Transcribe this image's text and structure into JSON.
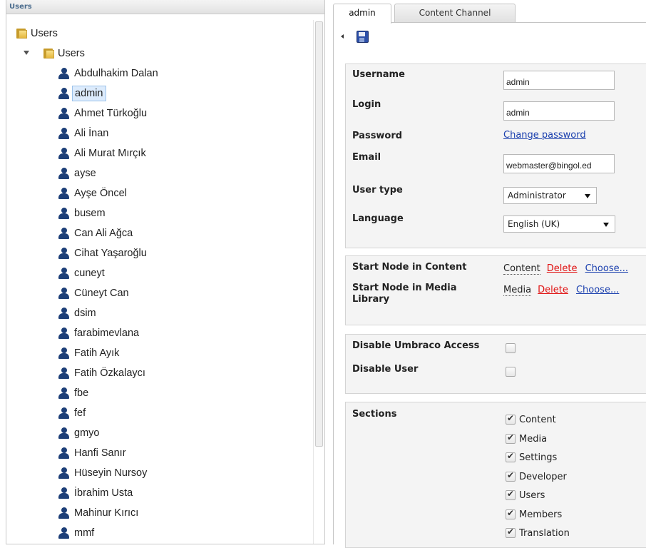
{
  "left": {
    "title": "Users",
    "root_label": "Users",
    "group_label": "Users",
    "users": [
      "Abdulhakim Dalan",
      "admin",
      "Ahmet Türkoğlu",
      "Ali İnan",
      "Ali Murat Mırçık",
      "ayse",
      "Ayşe Öncel",
      "busem",
      "Can Ali Ağca",
      "Cihat Yaşaroğlu",
      "cuneyt",
      "Cüneyt Can",
      "dsim",
      "farabimevlana",
      "Fatih Ayık",
      "Fatih Özkalaycı",
      "fbe",
      "fef",
      "gmyo",
      "Hanfi Sanır",
      "Hüseyin Nursoy",
      "İbrahim Usta",
      "Mahinur Kırıcı",
      "mmf"
    ],
    "selected_user": "admin"
  },
  "tabs": [
    "admin",
    "Content Channel"
  ],
  "form": {
    "username_label": "Username",
    "username_value": "admin",
    "login_label": "Login",
    "login_value": "admin",
    "password_label": "Password",
    "change_password": "Change password",
    "email_label": "Email",
    "email_value": "webmaster@bingol.ed",
    "usertype_label": "User type",
    "usertype_value": "Administrator",
    "language_label": "Language",
    "language_value": "English (UK)"
  },
  "start_nodes": {
    "content_label": "Start Node in Content",
    "content_node": "Content",
    "media_label": "Start Node in Media Library",
    "media_node": "Media",
    "delete_label": "Delete",
    "choose_label": "Choose..."
  },
  "access": {
    "disable_umbraco_label": "Disable Umbraco Access",
    "disable_user_label": "Disable User",
    "disable_umbraco_checked": false,
    "disable_user_checked": false
  },
  "sections": {
    "label": "Sections",
    "items": [
      "Content",
      "Media",
      "Settings",
      "Developer",
      "Users",
      "Members",
      "Translation"
    ]
  }
}
